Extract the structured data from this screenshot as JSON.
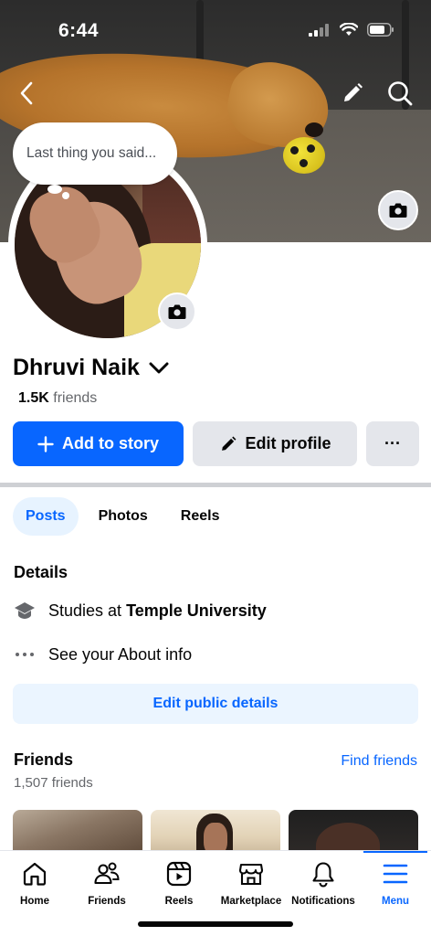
{
  "status_bar": {
    "time": "6:44"
  },
  "header": {
    "back_icon": "chevron-left-icon",
    "edit_icon": "pencil-icon",
    "search_icon": "search-icon"
  },
  "note": {
    "text": "Last thing you said..."
  },
  "profile": {
    "name": "Dhruvi Naik",
    "friends_count": "1.5K",
    "friends_label": "friends"
  },
  "actions": {
    "add_story": "Add to story",
    "edit_profile": "Edit profile",
    "more": "···"
  },
  "tabs": [
    {
      "label": "Posts",
      "active": true
    },
    {
      "label": "Photos",
      "active": false
    },
    {
      "label": "Reels",
      "active": false
    }
  ],
  "details": {
    "title": "Details",
    "studies_prefix": "Studies at",
    "school": "Temple University",
    "about": "See your About info",
    "edit_button": "Edit public details"
  },
  "friends": {
    "title": "Friends",
    "find": "Find friends",
    "count": "1,507 friends"
  },
  "bottom_nav": [
    {
      "label": "Home",
      "icon": "home-icon",
      "active": false
    },
    {
      "label": "Friends",
      "icon": "friends-icon",
      "active": false
    },
    {
      "label": "Reels",
      "icon": "reels-icon",
      "active": false
    },
    {
      "label": "Marketplace",
      "icon": "marketplace-icon",
      "active": false
    },
    {
      "label": "Notifications",
      "icon": "bell-icon",
      "active": false
    },
    {
      "label": "Menu",
      "icon": "menu-icon",
      "active": true
    }
  ],
  "colors": {
    "accent": "#0866ff",
    "secondary_button": "#e4e6eb",
    "muted_text": "#65676b"
  }
}
